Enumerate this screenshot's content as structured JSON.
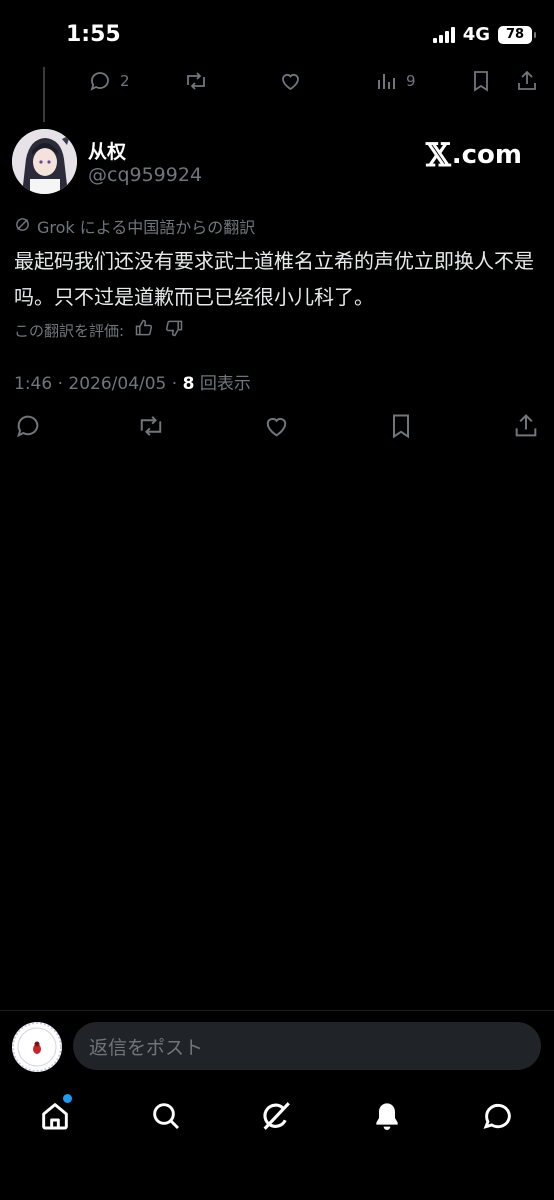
{
  "status": {
    "time": "1:55",
    "network": "4G",
    "battery": "78"
  },
  "previous_tweet": {
    "replies": "2",
    "views": "9"
  },
  "tweet": {
    "display_name": "从权",
    "handle": "@cq959924",
    "watermark": "X.com",
    "watermark_x": "𝕏",
    "watermark_rest": ".com",
    "translation_label": "Grok による中国語からの翻訳",
    "text": "最起码我们还没有要求武士道椎名立希的声优立即换人不是吗。只不过是道歉而已已经很小儿科了。",
    "rate_label": "この翻訳を評価:",
    "time": "1:46 · 2026/04/05 · ",
    "views_count": "8",
    "views_label": "回表示"
  },
  "reply": {
    "placeholder": "返信をポスト"
  },
  "colors": {
    "background": "#000000",
    "text": "#e7e9ea",
    "muted": "#71767b",
    "accent": "#1d9bf0",
    "input_bg": "#202327"
  },
  "nav": {
    "items": [
      "home-icon",
      "search-icon",
      "grok-icon",
      "bell-icon",
      "messages-icon"
    ]
  }
}
